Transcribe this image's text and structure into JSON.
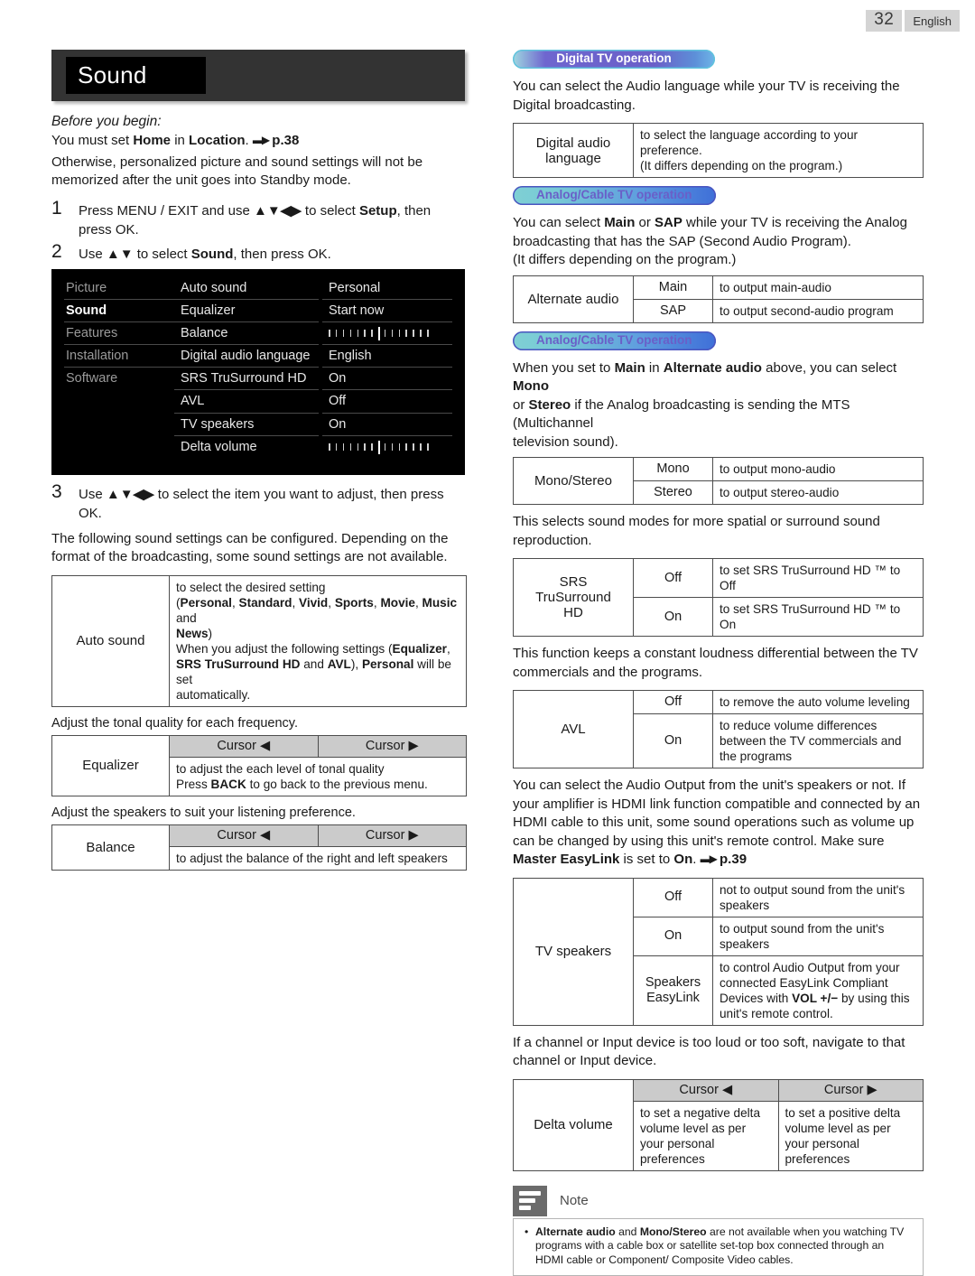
{
  "page": {
    "number": "32",
    "language": "English"
  },
  "chapter": {
    "title": "Sound"
  },
  "left": {
    "before_heading": "Before you begin:",
    "before_line": "You must set Home in Location. ➡ p.38",
    "before_body": "Otherwise, personalized picture and sound settings will not be memorized after the unit goes into Standby mode.",
    "steps": [
      {
        "n": "1",
        "text": "Press MENU / EXIT and use ▲▼◀▶ to select Setup, then press OK."
      },
      {
        "n": "2",
        "text": "Use ▲▼ to select Sound, then press OK."
      },
      {
        "n": "3",
        "text": "Use ▲▼◀▶ to select the item you want to adjust, then press OK."
      }
    ],
    "osd": {
      "categories": [
        "Picture",
        "Sound",
        "Features",
        "Installation",
        "Software"
      ],
      "selected_category": "Sound",
      "items": [
        "Auto sound",
        "Equalizer",
        "Balance",
        "Digital audio language",
        "SRS TruSurround HD",
        "AVL",
        "TV speakers",
        "Delta volume"
      ],
      "values": [
        "Personal",
        "Start now",
        "__SLIDER__",
        "English",
        "On",
        "Off",
        "On",
        "__SLIDER__"
      ]
    },
    "after_steps": "The following sound settings can be configured. Depending on the format of the broadcasting, some sound settings are not available.",
    "auto_sound": {
      "label": "Auto sound",
      "desc_l1": "to select the desired setting",
      "desc_l2": "(Personal, Standard, Vivid, Sports, Movie, Music and",
      "desc_l3": "News)",
      "desc_l4": "When you adjust the following settings (Equalizer,",
      "desc_l5": "SRS TruSurround HD and AVL), Personal will be set",
      "desc_l6": "automatically."
    },
    "equalizer": {
      "caption": "Adjust the tonal quality for each frequency.",
      "label": "Equalizer",
      "cursor_left": "Cursor ◀",
      "cursor_right": "Cursor ▶",
      "desc_l1": "to adjust the each level of tonal quality",
      "desc_l2": "Press BACK to go back to the previous menu."
    },
    "balance": {
      "caption": "Adjust the speakers to suit your listening preference.",
      "label": "Balance",
      "cursor_left": "Cursor ◀",
      "cursor_right": "Cursor ▶",
      "desc": "to adjust the balance of the right and left speakers"
    }
  },
  "right": {
    "pill_digital": "Digital TV operation",
    "pill_analog_1": "Analog/Cable TV operation",
    "pill_analog_2": "Analog/Cable TV operation",
    "intro_digital": "You can select the Audio language while your TV is receiving the Digital broadcasting.",
    "digital_audio_language": {
      "label_l1": "Digital audio",
      "label_l2": "language",
      "desc_l1": "to select the language according to your preference.",
      "desc_l2": "(It differs depending on the program.)"
    },
    "intro_analog_1_l1": "You can select Main or SAP while your TV is receiving the Analog",
    "intro_analog_1_l2": "broadcasting that has the SAP (Second Audio Program).",
    "intro_analog_1_l3": "(It differs depending on the program.)",
    "alternate_audio": {
      "label": "Alternate audio",
      "rows": [
        {
          "opt": "Main",
          "desc": "to output main-audio"
        },
        {
          "opt": "SAP",
          "desc": "to output second-audio program"
        }
      ]
    },
    "intro_analog_2_l1": "When you set to Main in Alternate audio above, you can select Mono",
    "intro_analog_2_l2": "or Stereo if the Analog broadcasting is sending the MTS (Multichannel",
    "intro_analog_2_l3": "television sound).",
    "mono_stereo": {
      "label": "Mono/Stereo",
      "rows": [
        {
          "opt": "Mono",
          "desc": "to output mono-audio"
        },
        {
          "opt": "Stereo",
          "desc": "to output stereo-audio"
        }
      ]
    },
    "srs_caption": "This selects sound modes for more spatial or surround sound reproduction.",
    "srs": {
      "label_l1": "SRS TruSurround",
      "label_l2": "HD",
      "rows": [
        {
          "opt": "Off",
          "desc": "to set SRS TruSurround HD ™ to Off"
        },
        {
          "opt": "On",
          "desc": "to set SRS TruSurround HD ™ to On"
        }
      ]
    },
    "avl_caption": "This function keeps a constant loudness differential between the TV commercials and the programs.",
    "avl": {
      "label": "AVL",
      "rows": [
        {
          "opt": "Off",
          "desc": "to remove the auto volume leveling"
        },
        {
          "opt": "On",
          "desc": "to reduce volume differences between the TV commercials and the programs"
        }
      ]
    },
    "tv_speakers_caption": "You can select the Audio Output from the unit's speakers or not. If your amplifier is HDMI link function compatible and connected by an HDMI cable to this unit, some sound operations such as volume up can be changed by using this unit's remote control. Make sure Master EasyLink is set to On. ➡ p.39",
    "tv_speakers": {
      "label": "TV speakers",
      "rows": [
        {
          "opt": "Off",
          "desc": "not to output sound from the unit's speakers"
        },
        {
          "opt": "On",
          "desc": "to output sound from the unit's speakers"
        },
        {
          "opt_l1": "Speakers",
          "opt_l2": "EasyLink",
          "desc": "to control Audio Output from your connected EasyLink Compliant Devices with VOL +/− by using this unit's remote control."
        }
      ]
    },
    "delta_caption": "If a channel or Input device is too loud or too soft, navigate to that channel or Input device.",
    "delta_volume": {
      "label": "Delta volume",
      "cursor_left": "Cursor ◀",
      "cursor_right": "Cursor ▶",
      "desc_left": "to set a negative delta volume level as per your personal preferences",
      "desc_right": "to set a positive delta volume level as per your personal preferences"
    },
    "note": {
      "title": "Note",
      "items": [
        "Alternate audio and Mono/Stereo are not available when you watching TV programs with a cable box or satellite set-top box connected through an HDMI cable or Component/ Composite Video cables."
      ]
    }
  }
}
